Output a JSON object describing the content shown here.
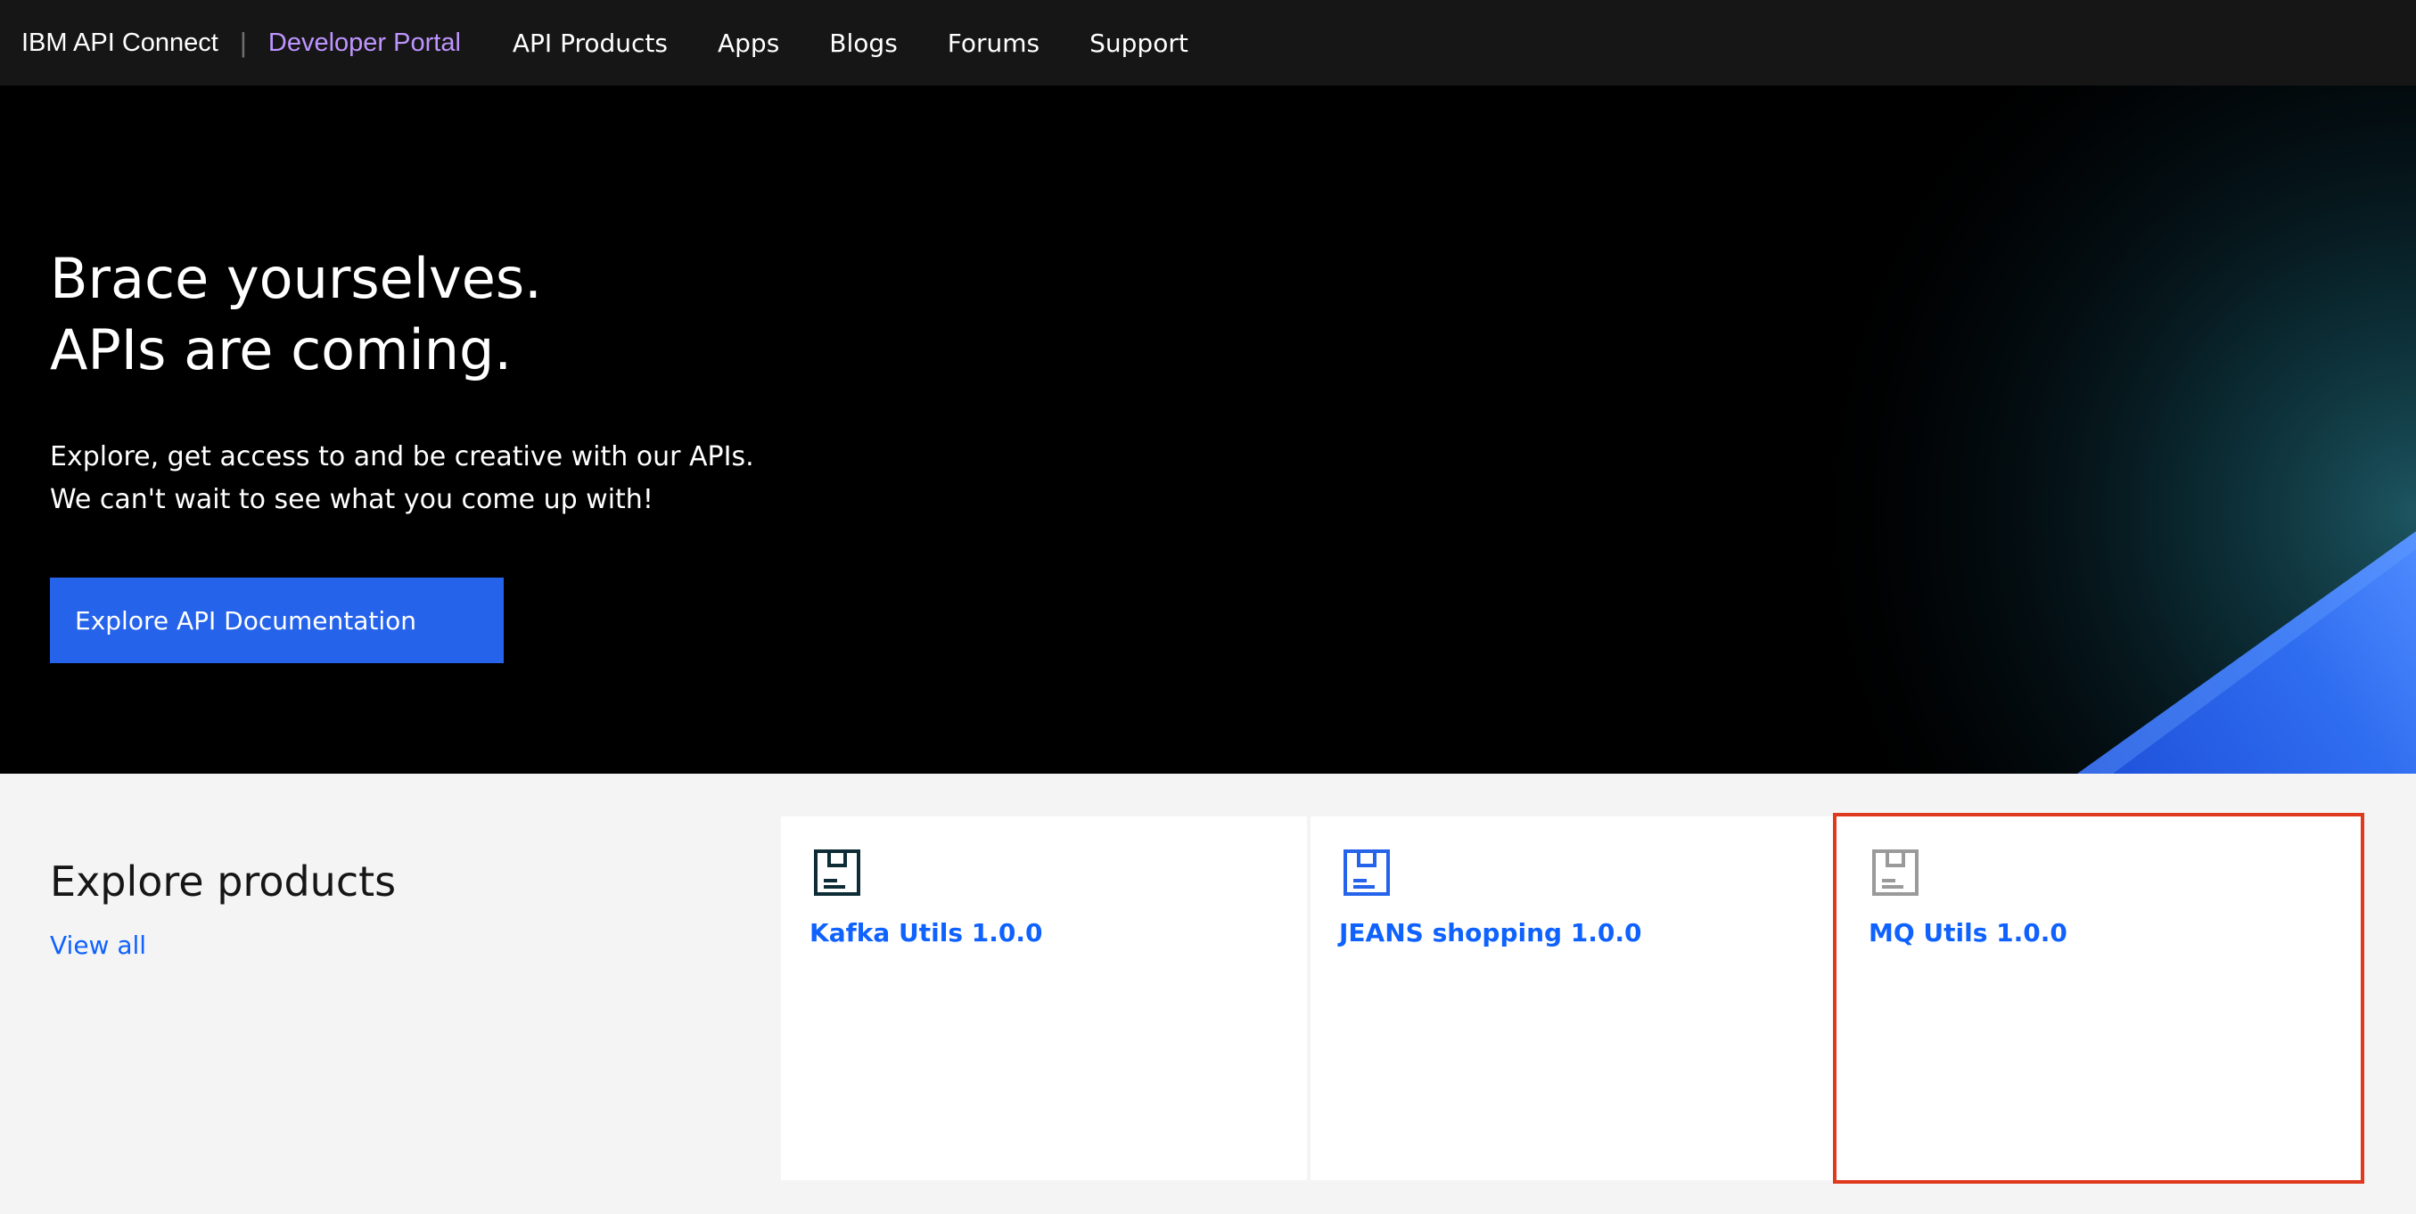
{
  "nav": {
    "brand": "IBM API Connect",
    "separator": "|",
    "portal": "Developer Portal",
    "links": [
      "API Products",
      "Apps",
      "Blogs",
      "Forums",
      "Support"
    ]
  },
  "hero": {
    "title_line1": "Brace yourselves.",
    "title_line2": "APIs are coming.",
    "sub_line1": "Explore, get access to and be creative with our APIs.",
    "sub_line2": "We can't wait to see what you come up with!",
    "button": "Explore API Documentation"
  },
  "products": {
    "title": "Explore products",
    "view_all": "View all",
    "cards": [
      {
        "label": "Kafka Utils 1.0.0",
        "icon": "product-package-icon",
        "icon_color": "#0e2c35"
      },
      {
        "label": "JEANS shopping 1.0.0",
        "icon": "product-package-icon",
        "icon_color": "#2563eb"
      },
      {
        "label": "MQ Utils 1.0.0",
        "icon": "product-package-icon",
        "icon_color": "#9a9a9a"
      }
    ]
  },
  "colors": {
    "nav_bg": "#161616",
    "portal_accent": "#be95ff",
    "button_bg": "#2563eb",
    "link": "#0f62fe",
    "highlight_border": "#e03a1e"
  }
}
